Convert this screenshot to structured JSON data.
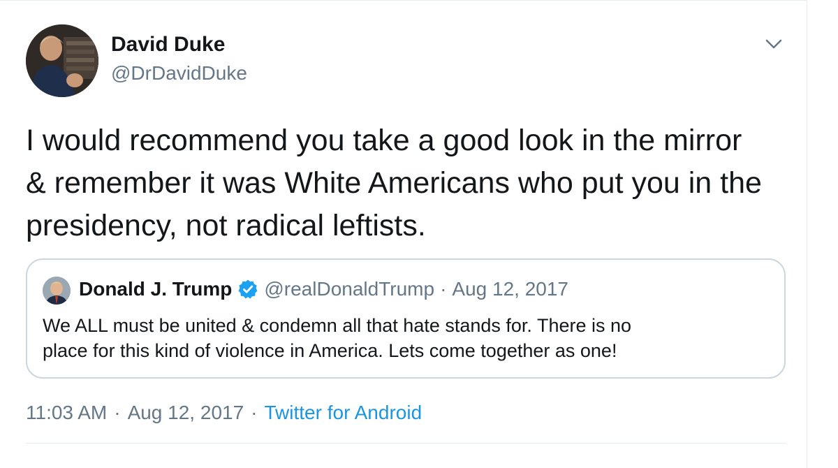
{
  "author": {
    "name": "David Duke",
    "handle": "@DrDavidDuke"
  },
  "tweet": {
    "lines": [
      "I would recommend you take a good look in the mirror",
      "& remember it was White Americans who put you in the",
      "presidency, not radical leftists."
    ]
  },
  "quoted": {
    "name": "Donald J. Trump",
    "handle": "@realDonaldTrump",
    "separator": "·",
    "date": "Aug 12, 2017",
    "lines": [
      "We ALL must be united & condemn all that hate stands for. There is no",
      "place for this kind of violence in America. Lets come together as one!"
    ]
  },
  "meta": {
    "time": "11:03 AM",
    "separator": "·",
    "date": "Aug 12, 2017",
    "source": "Twitter for Android"
  },
  "icons": {
    "caret": "chevron-down-icon",
    "verified": "verified-badge-icon"
  },
  "colors": {
    "primary_text": "#14171a",
    "secondary_text": "#657786",
    "link": "#1b95e0",
    "verified": "#1da1f2",
    "border": "#ccd6dd"
  }
}
